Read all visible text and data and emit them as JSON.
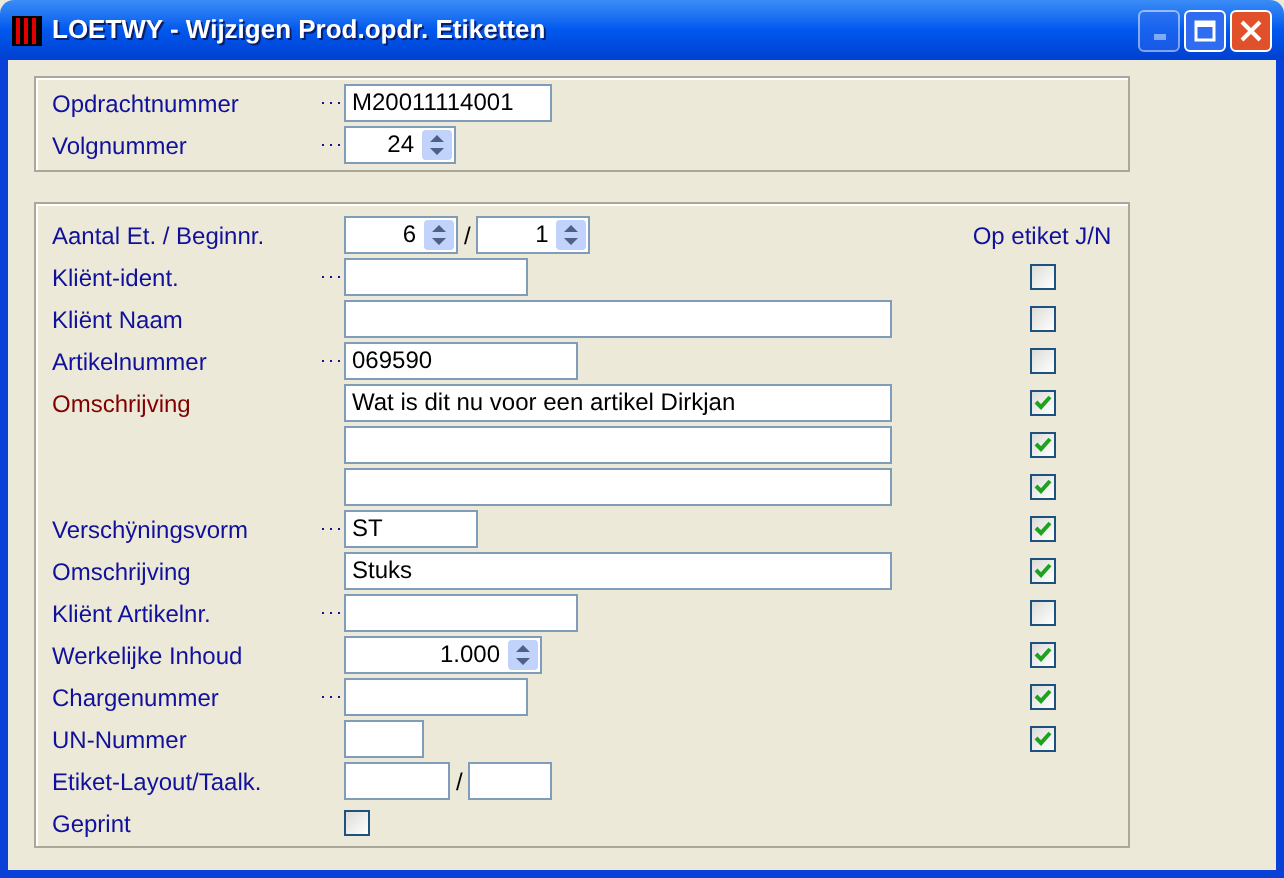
{
  "window": {
    "title": "LOETWY - Wijzigen Prod.opdr. Etiketten",
    "buttons": [
      {
        "kind": "minimize",
        "disabled": true
      },
      {
        "kind": "maximize",
        "disabled": false
      },
      {
        "kind": "close",
        "disabled": false
      }
    ]
  },
  "order_group": {
    "rows": [
      {
        "label": "Opdrachtnummer",
        "required": false,
        "lookup": true,
        "kind": "text",
        "value": "M20011114001"
      },
      {
        "label": "Volgnummer",
        "required": false,
        "lookup": true,
        "kind": "spin",
        "value": "24"
      }
    ]
  },
  "label_group": {
    "column_header": "Op etiket J/N",
    "rows": [
      {
        "label": "Aantal Et. / Beginnr.",
        "required": false,
        "lookup": false,
        "kind": "spin_pair",
        "values": [
          "6",
          "1"
        ],
        "separator": "/"
      },
      {
        "label": "Kliënt-ident.",
        "required": false,
        "lookup": true,
        "kind": "text",
        "on_label": false
      },
      {
        "label": "Kliënt Naam",
        "required": false,
        "lookup": false,
        "kind": "text",
        "on_label": false
      },
      {
        "label": "Artikelnummer",
        "required": false,
        "lookup": true,
        "kind": "text",
        "value": "069590",
        "on_label": false
      },
      {
        "label": "Omschrijving",
        "required": true,
        "lookup": false,
        "kind": "text",
        "value": "Wat is dit nu voor een artikel Dirkjan",
        "on_label": true
      },
      {
        "kind": "text",
        "lookup": false,
        "on_label": true
      },
      {
        "kind": "text",
        "lookup": false,
        "on_label": true
      },
      {
        "label": "Verschÿningsvorm",
        "required": false,
        "lookup": true,
        "kind": "text",
        "value": "ST",
        "on_label": true
      },
      {
        "label": "Omschrijving",
        "required": false,
        "lookup": false,
        "kind": "text",
        "value": "Stuks",
        "on_label": true
      },
      {
        "label": "Kliënt Artikelnr.",
        "required": false,
        "lookup": true,
        "kind": "text",
        "on_label": false
      },
      {
        "label": "Werkelijke Inhoud",
        "required": false,
        "lookup": false,
        "kind": "spin",
        "value": "1.000",
        "on_label": true
      },
      {
        "label": "Chargenummer",
        "required": false,
        "lookup": true,
        "kind": "text",
        "on_label": true
      },
      {
        "label": "UN-Nummer",
        "required": false,
        "lookup": false,
        "kind": "text",
        "on_label": true
      },
      {
        "label": "Etiket-Layout/Taalk.",
        "required": false,
        "lookup": false,
        "kind": "text_pair",
        "separator": "/"
      },
      {
        "label": "Geprint",
        "required": false,
        "lookup": false,
        "kind": "checkbox",
        "checked": false
      }
    ]
  }
}
